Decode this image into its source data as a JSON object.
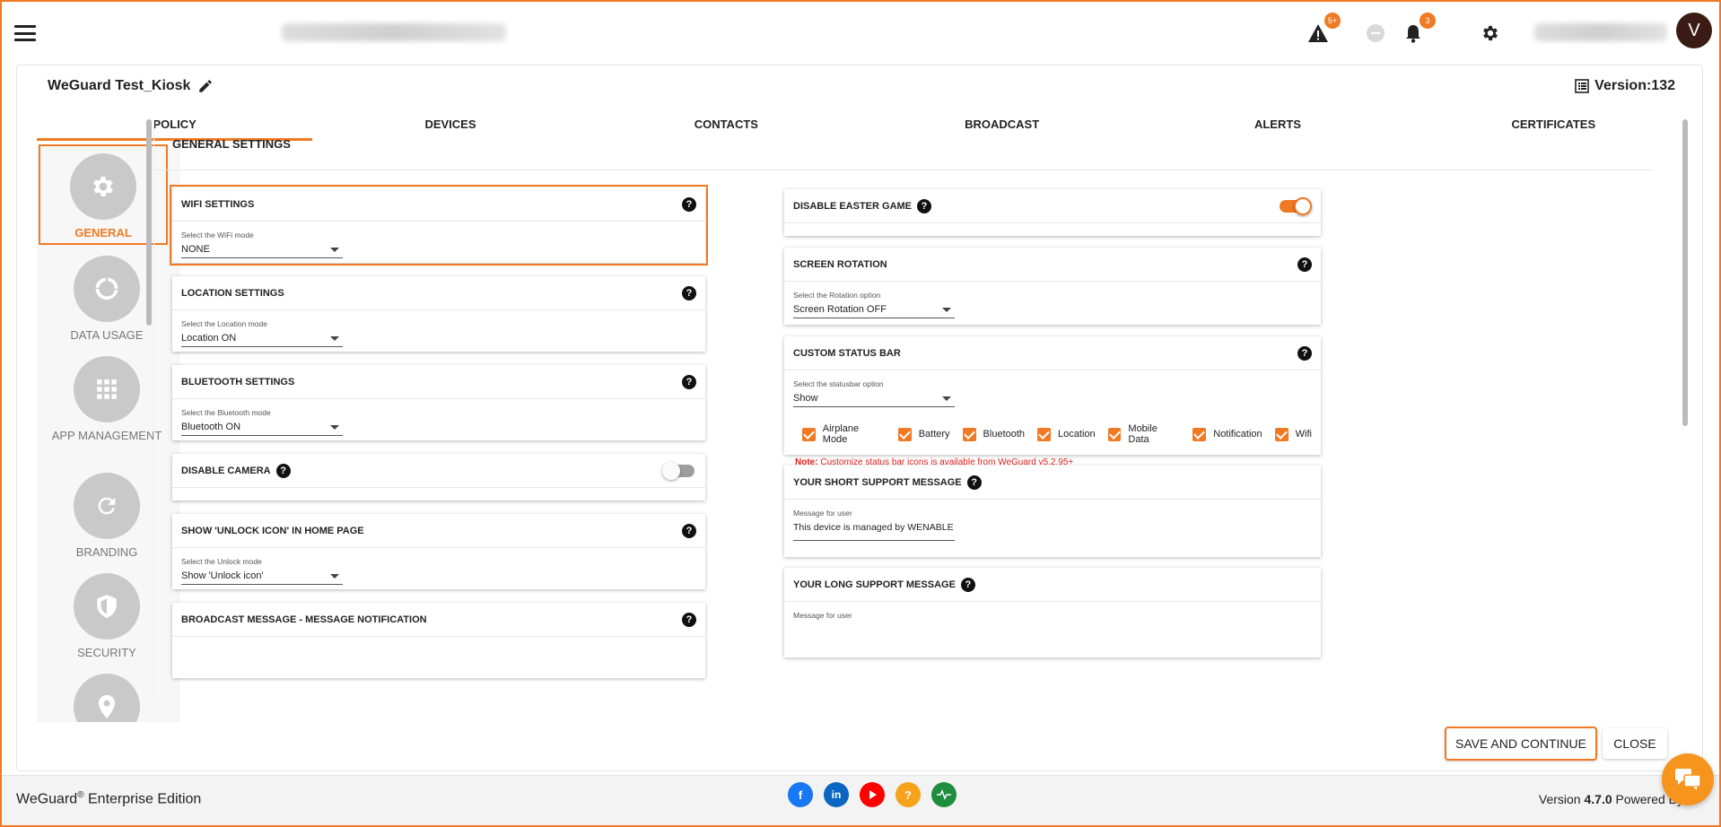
{
  "topbar": {
    "alerts_badge": "5+",
    "notifications_badge": "3",
    "avatar_letter": "V"
  },
  "policy": {
    "name": "WeGuard Test_Kiosk",
    "version": "Version:132"
  },
  "tabs": [
    "POLICY",
    "DEVICES",
    "CONTACTS",
    "BROADCAST",
    "ALERTS",
    "CERTIFICATES"
  ],
  "sidenav": {
    "general": "GENERAL",
    "data_usage": "DATA USAGE",
    "app_management": "APP MANAGEMENT",
    "branding": "BRANDING",
    "security": "SECURITY"
  },
  "content": {
    "header": "GENERAL SETTINGS",
    "wifi": {
      "title": "WIFI SETTINGS",
      "label": "Select the WiFi mode",
      "value": "NONE"
    },
    "location": {
      "title": "LOCATION SETTINGS",
      "label": "Select the Location mode",
      "value": "Location ON"
    },
    "bluetooth": {
      "title": "BLUETOOTH SETTINGS",
      "label": "Select the Bluetooth mode",
      "value": "Bluetooth ON"
    },
    "camera": {
      "title": "DISABLE CAMERA"
    },
    "unlock": {
      "title": "SHOW 'UNLOCK ICON' IN HOME PAGE",
      "label": "Select the Unlock mode",
      "value": "Show 'Unlock icon'"
    },
    "broadcast": {
      "title": "BROADCAST MESSAGE - MESSAGE NOTIFICATION"
    },
    "easter": {
      "title": "DISABLE EASTER GAME"
    },
    "rotation": {
      "title": "SCREEN ROTATION",
      "label": "Select the Rotation option",
      "value": "Screen Rotation OFF"
    },
    "statusbar": {
      "title": "CUSTOM STATUS BAR",
      "label": "Select the statusbar option",
      "value": "Show",
      "checks": [
        "Airplane Mode",
        "Battery",
        "Bluetooth",
        "Location",
        "Mobile Data",
        "Notification",
        "Wifi"
      ],
      "note_prefix": "Note:",
      "note_text": " Customize status bar icons is available from WeGuard v5.2.95+"
    },
    "short_msg": {
      "title": "YOUR SHORT SUPPORT MESSAGE",
      "label": "Message for user",
      "value": "This device is managed by WENABLE"
    },
    "long_msg": {
      "title": "YOUR LONG SUPPORT MESSAGE",
      "label": "Message for user"
    }
  },
  "actions": {
    "save": "SAVE AND CONTINUE",
    "close": "CLOSE"
  },
  "footer": {
    "brand": "WeGuard",
    "reg": "®",
    "edition": " Enterprise Edition",
    "version_prefix": "Version ",
    "version_number": "4.7.0",
    "powered": "  Powered By"
  },
  "colors": {
    "accent": "#f07a24",
    "facebook": "#1877f2",
    "linkedin": "#0a66c2",
    "youtube": "#ff0000",
    "help": "#f7a21b",
    "status": "#1e8e3e"
  }
}
